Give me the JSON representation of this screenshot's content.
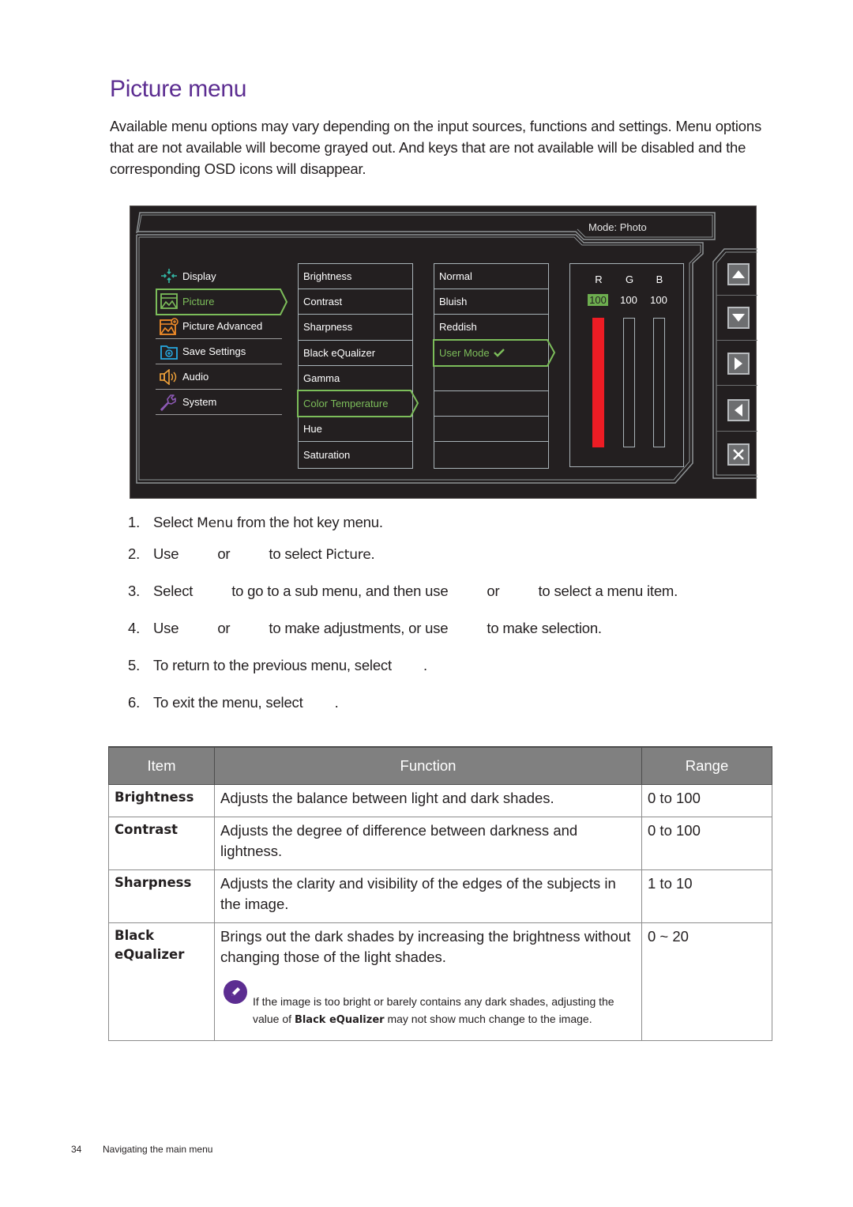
{
  "page": {
    "title": "Picture menu",
    "intro": "Available menu options may vary depending on the input sources, functions and settings. Menu options that are not available will become grayed out. And keys that are not available will be disabled and the corresponding OSD icons will disappear."
  },
  "osd": {
    "mode_label": "Mode: Photo",
    "main_menu": [
      {
        "label": "Display",
        "icon": "display-icon",
        "color": "#33b5a4"
      },
      {
        "label": "Picture",
        "icon": "picture-icon",
        "color": "#7cbd5a",
        "selected": true
      },
      {
        "label": "Picture Advanced",
        "icon": "picture-advanced-icon",
        "color": "#f28c28"
      },
      {
        "label": "Save Settings",
        "icon": "save-settings-icon",
        "color": "#27a9e1"
      },
      {
        "label": "Audio",
        "icon": "audio-icon",
        "color": "#f2a33a"
      },
      {
        "label": "System",
        "icon": "system-icon",
        "color": "#8d59b5"
      }
    ],
    "sub_menu": [
      "Brightness",
      "Contrast",
      "Sharpness",
      "Black eQualizer",
      "Gamma",
      "Color Temperature",
      "Hue",
      "Saturation"
    ],
    "sub_menu_selected": "Color Temperature",
    "options": [
      "Normal",
      "Bluish",
      "Reddish",
      "User Mode",
      "",
      "",
      "",
      ""
    ],
    "options_selected": "User Mode",
    "rgb": {
      "headers": [
        "R",
        "G",
        "B"
      ],
      "values": [
        "100",
        "100",
        "100"
      ],
      "active_channel": "R",
      "active_fill_percent": 100,
      "colors": {
        "R": "#ed1c24"
      }
    },
    "keys": [
      "up-key",
      "down-key",
      "right-key",
      "left-key",
      "close-key"
    ],
    "accent_color": "#7cbd5a"
  },
  "steps": [
    {
      "num": "1.",
      "parts": [
        "Select ",
        "Menu",
        " from the hot key menu."
      ]
    },
    {
      "num": "2.",
      "parts": [
        "Use",
        "or",
        "to select ",
        "Picture",
        "."
      ]
    },
    {
      "num": "3.",
      "parts": [
        "Select",
        "to go to a sub menu, and then use",
        "or",
        "to select a menu item."
      ]
    },
    {
      "num": "4.",
      "parts": [
        "Use",
        "or",
        "to make adjustments, or use",
        "to make selection."
      ]
    },
    {
      "num": "5.",
      "parts": [
        "To return to the previous menu, select",
        "."
      ]
    },
    {
      "num": "6.",
      "parts": [
        "To exit the menu, select",
        "."
      ]
    }
  ],
  "table": {
    "headers": [
      "Item",
      "Function",
      "Range"
    ],
    "rows": [
      {
        "item": "Brightness",
        "function": "Adjusts the balance between light and dark shades.",
        "range": "0 to 100"
      },
      {
        "item": "Contrast",
        "function": "Adjusts the degree of difference between darkness and lightness.",
        "range": "0 to 100"
      },
      {
        "item": "Sharpness",
        "function": "Adjusts the clarity and visibility of the edges of the subjects in the image.",
        "range": "1 to 10"
      },
      {
        "item": "Black eQualizer",
        "function": "Brings out the dark shades by increasing the brightness without changing those of the light shades.",
        "range": "0 ~ 20",
        "note": {
          "pre": "If the image is too bright or barely contains any dark shades, adjusting the value of ",
          "bold": "Black eQualizer",
          "post": " may not show much change to the image."
        }
      }
    ]
  },
  "footer": {
    "page_number": "34",
    "section": "Navigating the main menu"
  }
}
